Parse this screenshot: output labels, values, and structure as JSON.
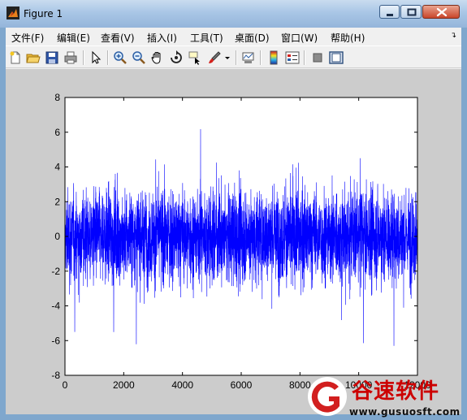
{
  "window": {
    "title": "Figure 1",
    "controls": [
      "minimize",
      "maximize",
      "close"
    ]
  },
  "menubar": {
    "items": [
      {
        "label": "文件(F)"
      },
      {
        "label": "编辑(E)"
      },
      {
        "label": "查看(V)"
      },
      {
        "label": "插入(I)"
      },
      {
        "label": "工具(T)"
      },
      {
        "label": "桌面(D)"
      },
      {
        "label": "窗口(W)"
      },
      {
        "label": "帮助(H)"
      }
    ],
    "overflow_icon": "chevron-icon"
  },
  "toolbar": {
    "icons": [
      "new-figure-icon",
      "open-file-icon",
      "save-icon",
      "print-icon",
      "select-arrow-icon",
      "zoom-in-icon",
      "zoom-out-icon",
      "pan-hand-icon",
      "rotate-3d-icon",
      "data-cursor-icon",
      "brush-icon",
      "link-plot-icon",
      "colorbar-icon",
      "legend-icon",
      "hide-plot-tools-icon",
      "show-plot-tools-icon"
    ]
  },
  "chart_data": {
    "type": "line",
    "title": "",
    "xlabel": "",
    "ylabel": "",
    "xlim": [
      0,
      12000
    ],
    "ylim": [
      -8,
      8
    ],
    "x_ticks": [
      "0",
      "2000",
      "4000",
      "6000",
      "8000",
      "10000",
      "12000"
    ],
    "y_ticks": [
      "8",
      "6",
      "4",
      "2",
      "0",
      "-2",
      "-4",
      "-6",
      "-8"
    ],
    "series": [
      {
        "color": "#0000ff",
        "n_points": 12000,
        "x_range": [
          0,
          12000
        ],
        "approx_envelope": [
          -7,
          7.7
        ],
        "dense_band": [
          -3,
          3
        ]
      }
    ],
    "grid": false
  },
  "watermark": {
    "brand": "谷速软件",
    "url": "www.gusuosft.com"
  }
}
